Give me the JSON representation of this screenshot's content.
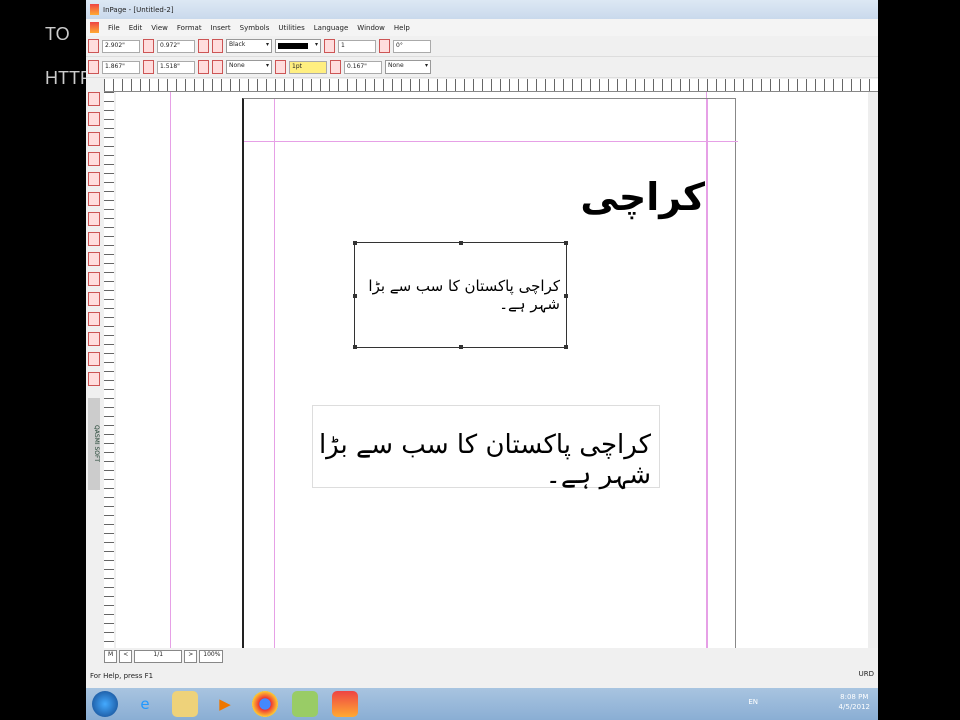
{
  "watermark": {
    "line1": "TO",
    "line2": "HTTP"
  },
  "window": {
    "title": "InPage - [Untitled-2]"
  },
  "menu": [
    "File",
    "Edit",
    "View",
    "Format",
    "Insert",
    "Symbols",
    "Utilities",
    "Language",
    "Window",
    "Help"
  ],
  "toolbar": {
    "x": "2.902\"",
    "y": "1.867\"",
    "w": "0.972\"",
    "h": "1.518\"",
    "color": "Black",
    "fill": "None",
    "lines": "1",
    "stroke": "1pt",
    "angle": "0°",
    "inset": "0.167\"",
    "wrap": "None"
  },
  "tools_brand": "QASMI SOFT",
  "document": {
    "heading": "کراچی",
    "sentence_small": "کراچی پاکستان کا سب سے بڑا شہر ہے۔",
    "sentence_large": "کراچی پاکستان کا سب سے بڑا شہر ہے۔"
  },
  "nav": {
    "first": "M",
    "prev": "<",
    "page": "1/1",
    "next": ">",
    "zoom": "100%"
  },
  "status": {
    "help": "For Help, press F1",
    "lang": "URD"
  },
  "taskbar": {
    "lang": "EN",
    "time": "8:08 PM",
    "date": "4/5/2012"
  }
}
